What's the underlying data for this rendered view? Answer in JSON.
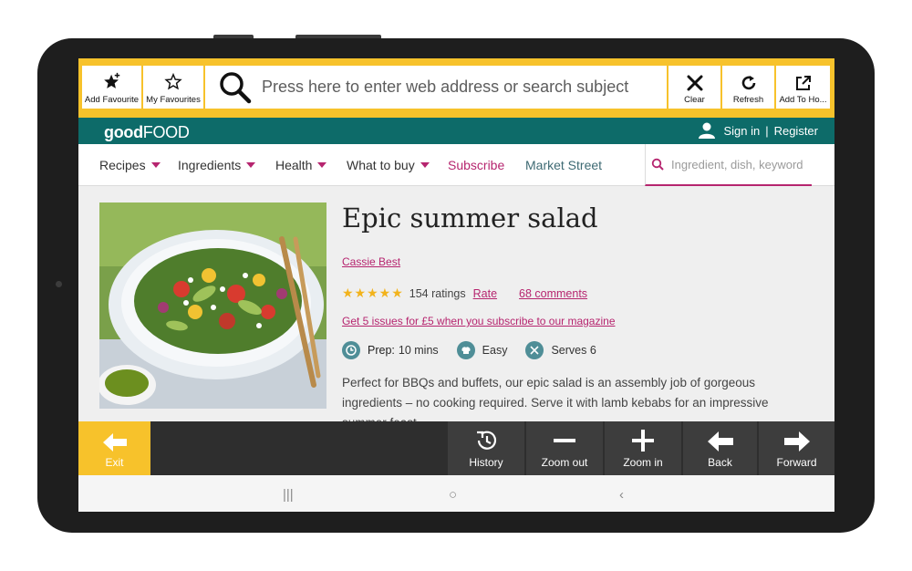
{
  "toolbar": {
    "add_favourite": "Add Favourite",
    "my_favourites": "My Favourites",
    "address_placeholder": "Press here to enter web address or search subject",
    "clear": "Clear",
    "refresh": "Refresh",
    "add_to_home": "Add To Ho..."
  },
  "site": {
    "logo_good": "good",
    "logo_food": "FOOD",
    "sign_in": "Sign in",
    "separator": "|",
    "register": "Register"
  },
  "nav": {
    "items": [
      {
        "label": "Recipes"
      },
      {
        "label": "Ingredients"
      },
      {
        "label": "Health"
      },
      {
        "label": "What to buy"
      }
    ],
    "subscribe": "Subscribe",
    "market_street": "Market Street",
    "search_placeholder": "Ingredient, dish, keyword"
  },
  "recipe": {
    "title": "Epic summer salad",
    "author": "Cassie Best",
    "stars": "★★★★★",
    "ratings": "154 ratings",
    "rate": "Rate",
    "comments": "68 comments",
    "promo": "Get 5 issues for £5 when you subscribe to our magazine",
    "prep_label": "Prep:",
    "prep_value": "10 mins",
    "difficulty": "Easy",
    "serves": "Serves 6",
    "description": "Perfect for BBQs and buffets, our epic salad is an assembly job of gorgeous ingredients – no cooking required. Serve it with lamb kebabs for an impressive summer feast."
  },
  "bottombar": {
    "exit": "Exit",
    "history": "History",
    "zoom_out": "Zoom out",
    "zoom_in": "Zoom in",
    "back": "Back",
    "forward": "Forward"
  },
  "android_nav": {
    "recents": "|||",
    "home": "○",
    "back": "‹"
  },
  "colors": {
    "toolbar_yellow": "#f7c22b",
    "brand_teal": "#0d6b69",
    "accent_magenta": "#b6256f",
    "star_gold": "#f2b31c"
  }
}
